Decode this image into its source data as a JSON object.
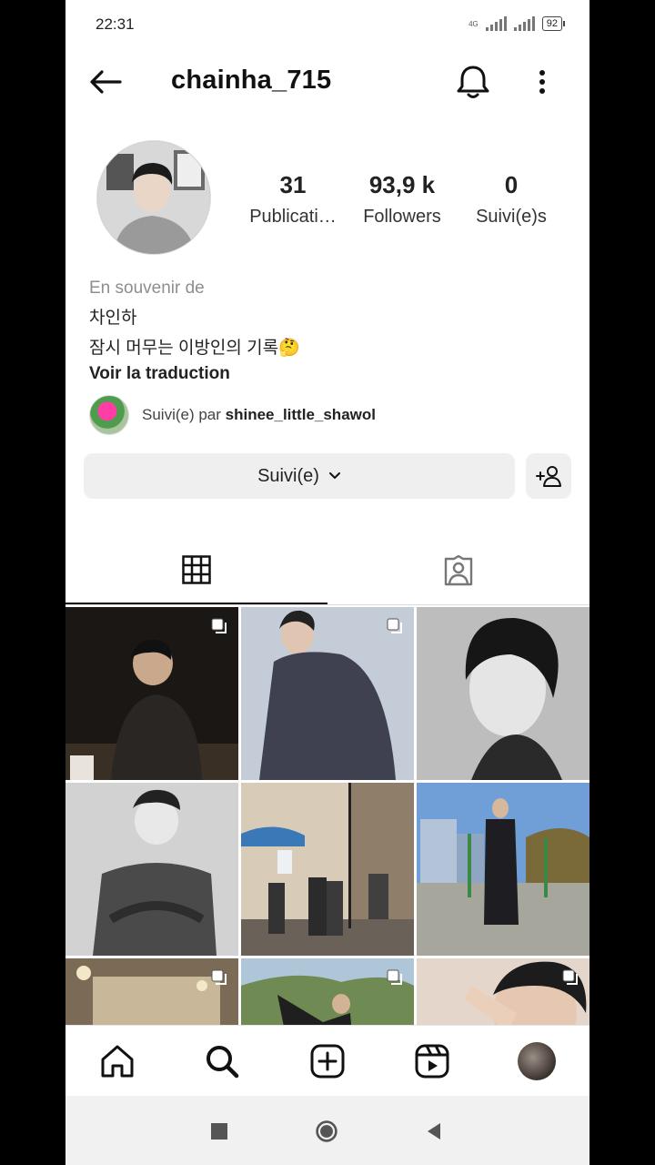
{
  "status_bar": {
    "time": "22:31",
    "network": "4G",
    "battery": "92"
  },
  "header": {
    "username": "chainha_715"
  },
  "stats": [
    {
      "value": "31",
      "label": "Publicati…"
    },
    {
      "value": "93,9 k",
      "label": "Followers"
    },
    {
      "value": "0",
      "label": "Suivi(e)s"
    }
  ],
  "bio": {
    "category": "En souvenir de",
    "lines": [
      "차인하",
      "잠시 머무는 이방인의 기록🤔"
    ],
    "translate": "Voir la traduction"
  },
  "followed_by": {
    "prefix": "Suivi(e) par ",
    "user": "shinee_little_shawol"
  },
  "actions": {
    "follow_label": "Suivi(e)"
  },
  "tabs": [
    {
      "icon": "grid-icon"
    },
    {
      "icon": "tagged-icon"
    }
  ],
  "nav": [
    "home-icon",
    "search-icon",
    "new-post-icon",
    "reels-icon",
    "profile-avatar"
  ],
  "colors": {
    "background": "#ffffff",
    "button": "#efefef",
    "muted": "#8e8e8e"
  }
}
